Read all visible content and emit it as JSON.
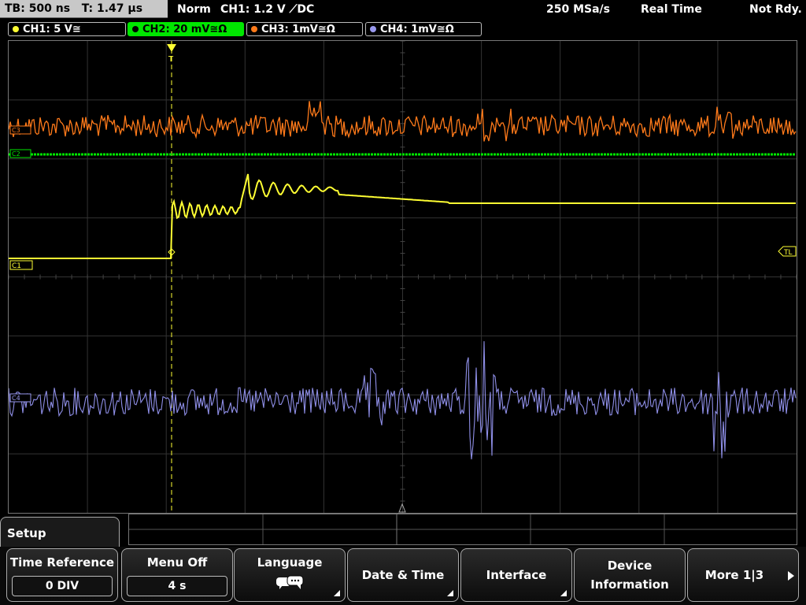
{
  "status_bar": {
    "timebase": "TB: 500 ns   T: 1.47 µs",
    "trigger_mode": "Norm",
    "trigger_info": "CH1: 1.2 V ⟋DC",
    "sample_rate": "250 MSa/s",
    "acquisition_mode": "Real Time",
    "status": "Not Rdy."
  },
  "channels": [
    {
      "label": "CH1: 5 V≅",
      "color": "#ffff33",
      "active": false
    },
    {
      "label": "CH2: 20 mV≅Ω",
      "color": "#00e600",
      "active": true
    },
    {
      "label": "CH3: 1mV≅Ω",
      "color": "#ff7a1a",
      "active": false
    },
    {
      "label": "CH4: 1mV≅Ω",
      "color": "#9999ee",
      "active": false
    }
  ],
  "markers": {
    "ch1": "C1",
    "ch2": "C2",
    "ch3": "C3",
    "ch4": "C4",
    "trigger_level": "TL",
    "trigger_position": "T"
  },
  "menu": {
    "title": "Setup",
    "time_reference": {
      "label": "Time Reference",
      "value": "0 DIV"
    },
    "menu_off": {
      "label": "Menu Off",
      "value": "4 s"
    },
    "language": {
      "label": "Language",
      "icon": "speech-bubbles-icon"
    },
    "date_time": {
      "label": "Date & Time"
    },
    "interface": {
      "label": "Interface"
    },
    "device_info": {
      "label_line1": "Device",
      "label_line2": "Information"
    },
    "more": {
      "label": "More 1|3",
      "icon": "arrow-right-icon"
    }
  }
}
